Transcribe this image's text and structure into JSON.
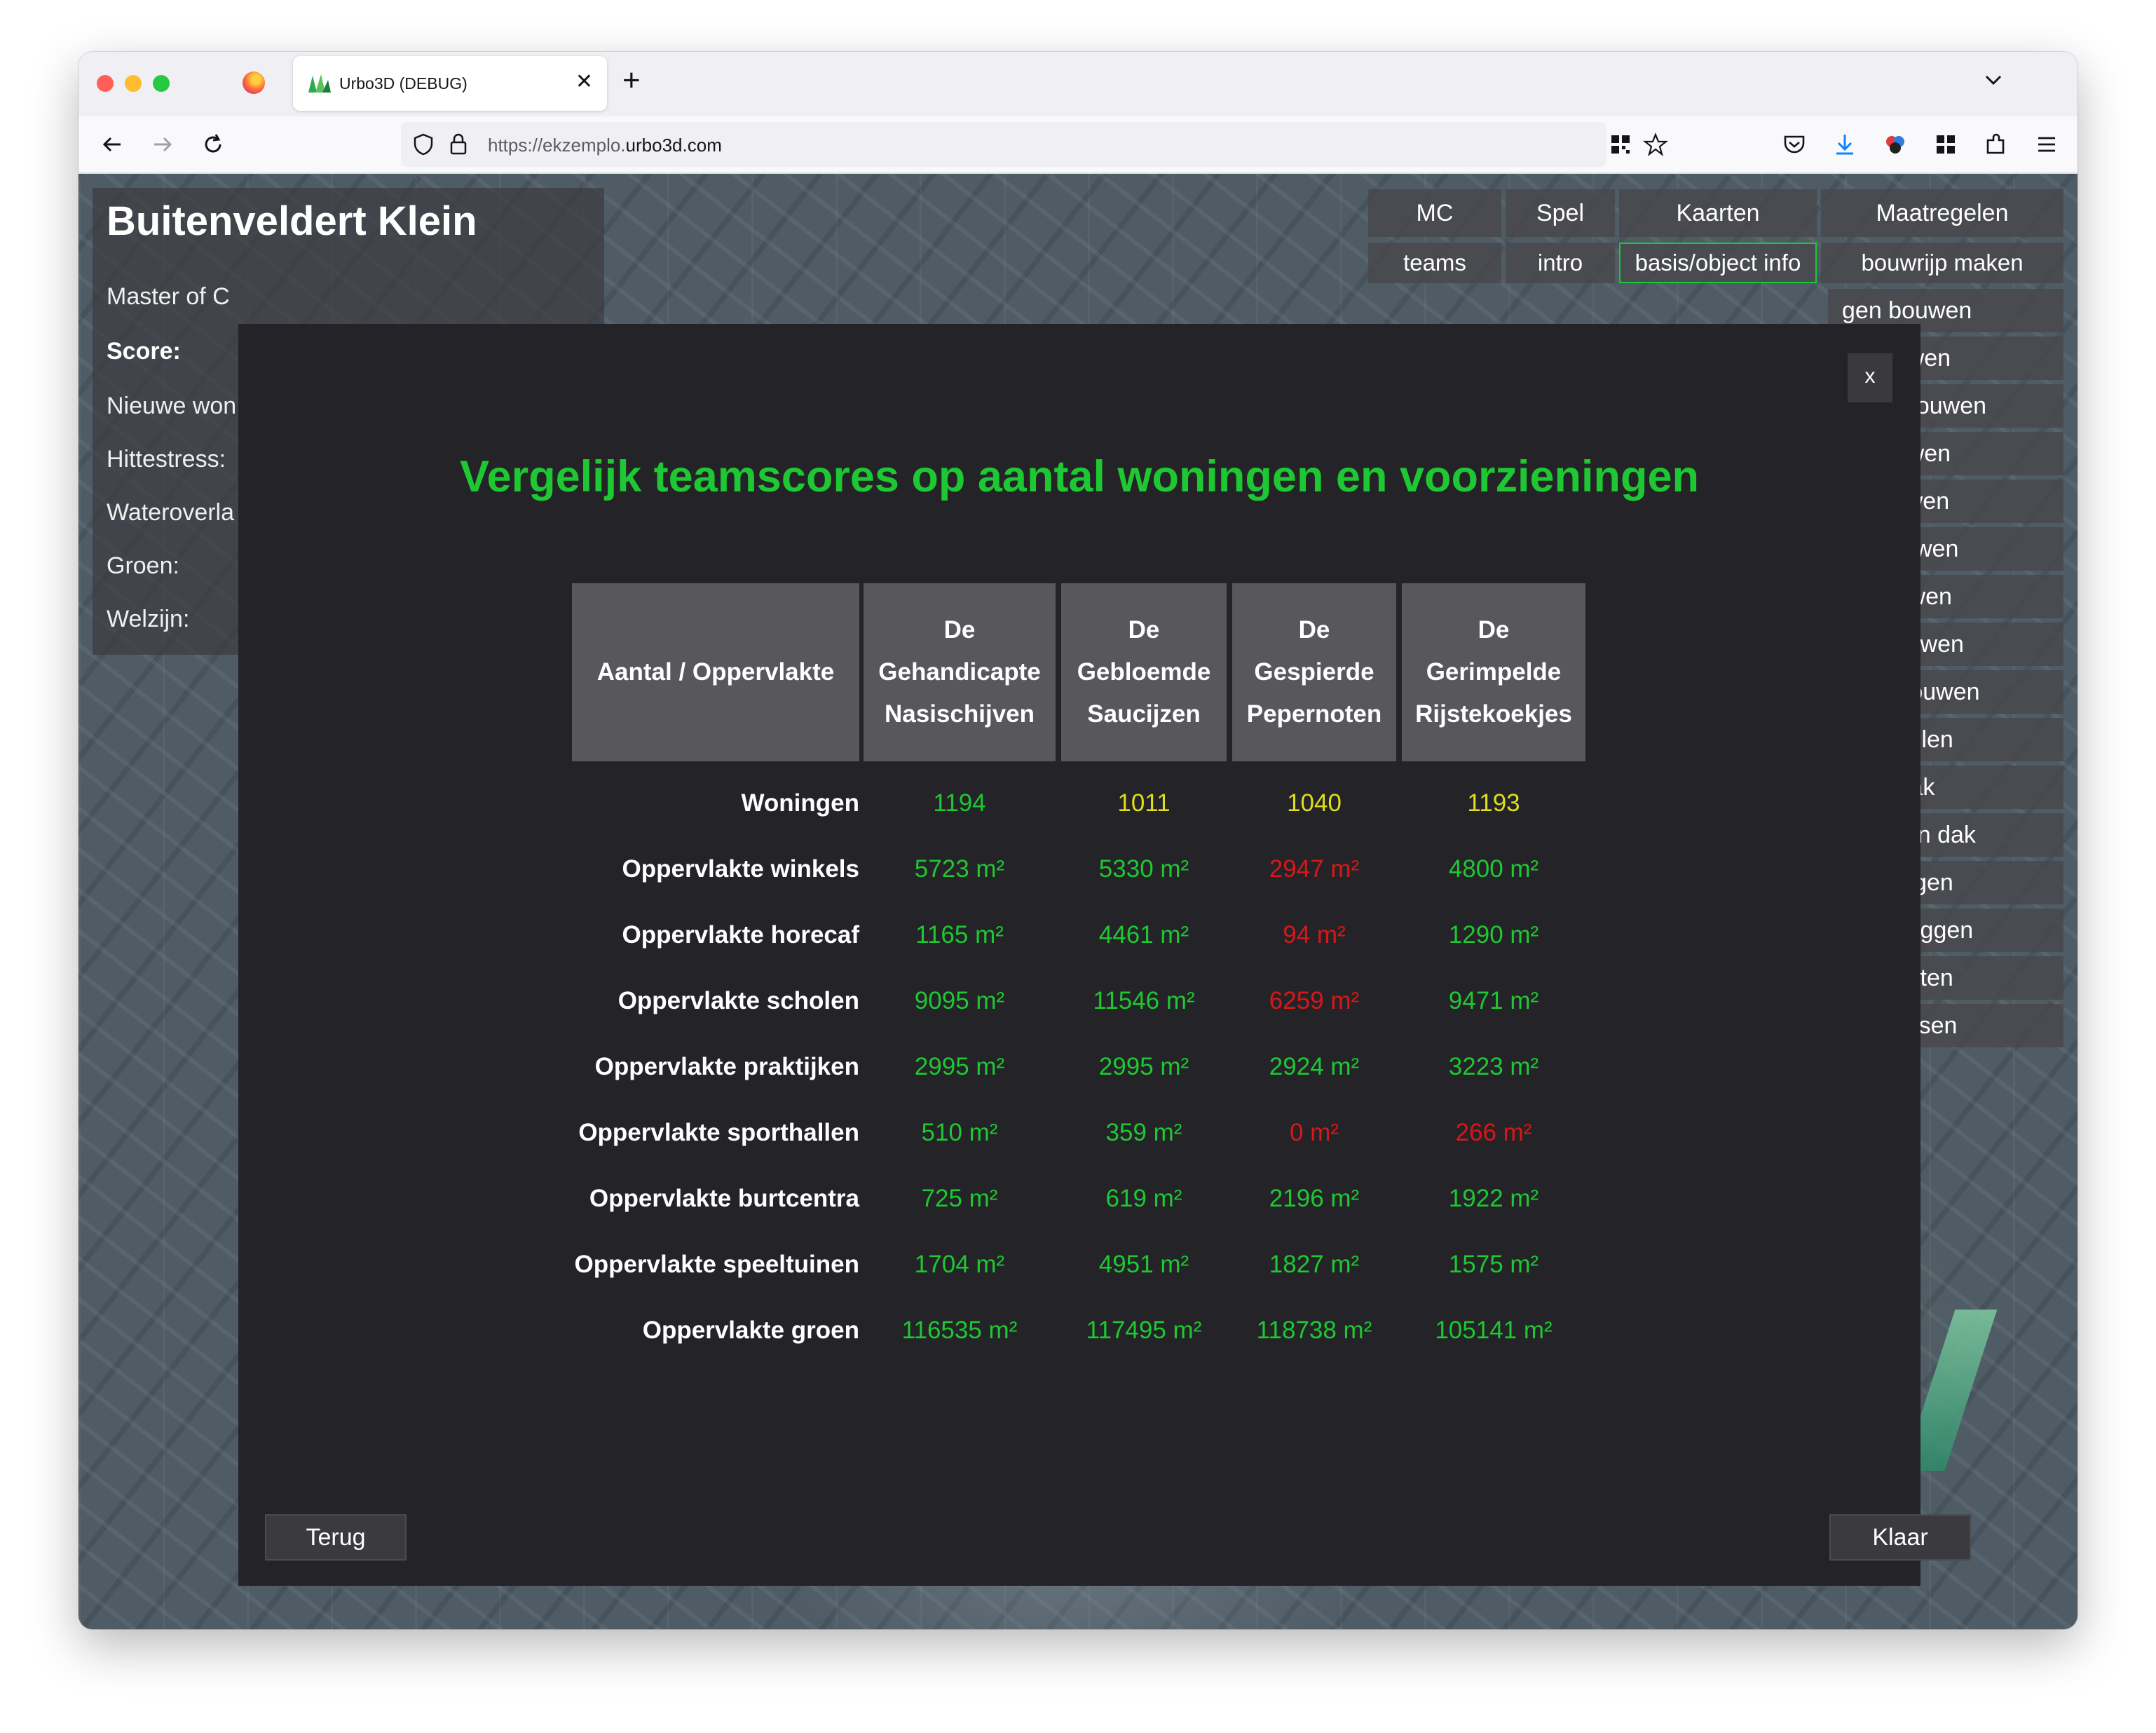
{
  "browser": {
    "tab_title": "Urbo3D (DEBUG)",
    "url_prefix": "https://ekzemplo.",
    "url_domain": "urbo3d.com",
    "tab_close": "✕",
    "new_tab": "+"
  },
  "location": {
    "title": "Buitenveldert Klein",
    "subtitle": "Master of C",
    "score_label": "Score:",
    "scores": [
      "Nieuwe won",
      "Hittestress:",
      "Wateroverla",
      "Groen:",
      "Welzijn:"
    ]
  },
  "menu": {
    "heads": [
      "MC",
      "Spel",
      "Kaarten",
      "Maatregelen"
    ],
    "subs": [
      "teams",
      "intro",
      "basis/object info",
      "bouwrijp maken"
    ],
    "items": [
      "gen bouwen",
      "ol bouwen",
      "aktijk bouwen",
      "al bouwen",
      "ls bouwen",
      "en bouwen",
      "af bouwen",
      "hal bouwen",
      "trum bouwen",
      "onttegelen",
      "roen dak",
      "er groen dak",
      "aanleggen",
      "n aanleggen",
      "en planten",
      "in plaatsen"
    ]
  },
  "modal": {
    "close_label": "x",
    "title": "Vergelijk teamscores op aantal woningen en voorzieningen",
    "header_label": "Aantal / Oppervlakte",
    "teams": [
      "De Gehandicapte Nasischijven",
      "De Gebloemde Saucijzen",
      "De Gespierde Pepernoten",
      "De Gerimpelde Rijstekoekjes"
    ],
    "rows": [
      {
        "label": "Woningen",
        "values": [
          "1194",
          "1011",
          "1040",
          "1193"
        ],
        "colors": [
          "green",
          "yellow",
          "yellow",
          "yellow"
        ]
      },
      {
        "label": "Oppervlakte winkels",
        "values": [
          "5723 m²",
          "5330 m²",
          "2947 m²",
          "4800 m²"
        ],
        "colors": [
          "green",
          "green",
          "red",
          "green"
        ]
      },
      {
        "label": "Oppervlakte horecaf",
        "values": [
          "1165 m²",
          "4461 m²",
          "94 m²",
          "1290 m²"
        ],
        "colors": [
          "green",
          "green",
          "red",
          "green"
        ]
      },
      {
        "label": "Oppervlakte scholen",
        "values": [
          "9095 m²",
          "11546 m²",
          "6259 m²",
          "9471 m²"
        ],
        "colors": [
          "green",
          "green",
          "red",
          "green"
        ]
      },
      {
        "label": "Oppervlakte praktijken",
        "values": [
          "2995 m²",
          "2995 m²",
          "2924 m²",
          "3223 m²"
        ],
        "colors": [
          "green",
          "green",
          "green",
          "green"
        ]
      },
      {
        "label": "Oppervlakte sporthallen",
        "values": [
          "510 m²",
          "359 m²",
          "0 m²",
          "266 m²"
        ],
        "colors": [
          "green",
          "green",
          "red",
          "red"
        ]
      },
      {
        "label": "Oppervlakte burtcentra",
        "values": [
          "725 m²",
          "619 m²",
          "2196 m²",
          "1922 m²"
        ],
        "colors": [
          "green",
          "green",
          "green",
          "green"
        ]
      },
      {
        "label": "Oppervlakte speeltuinen",
        "values": [
          "1704 m²",
          "4951 m²",
          "1827 m²",
          "1575 m²"
        ],
        "colors": [
          "green",
          "green",
          "green",
          "green"
        ]
      },
      {
        "label": "Oppervlakte groen",
        "values": [
          "116535 m²",
          "117495 m²",
          "118738 m²",
          "105141 m²"
        ],
        "colors": [
          "green",
          "green",
          "green",
          "green"
        ]
      }
    ],
    "back_label": "Terug",
    "done_label": "Klaar"
  },
  "colors": {
    "green": "#1ec832",
    "yellow": "#dede1a",
    "red": "#d81818",
    "title_green": "#1ec832"
  }
}
